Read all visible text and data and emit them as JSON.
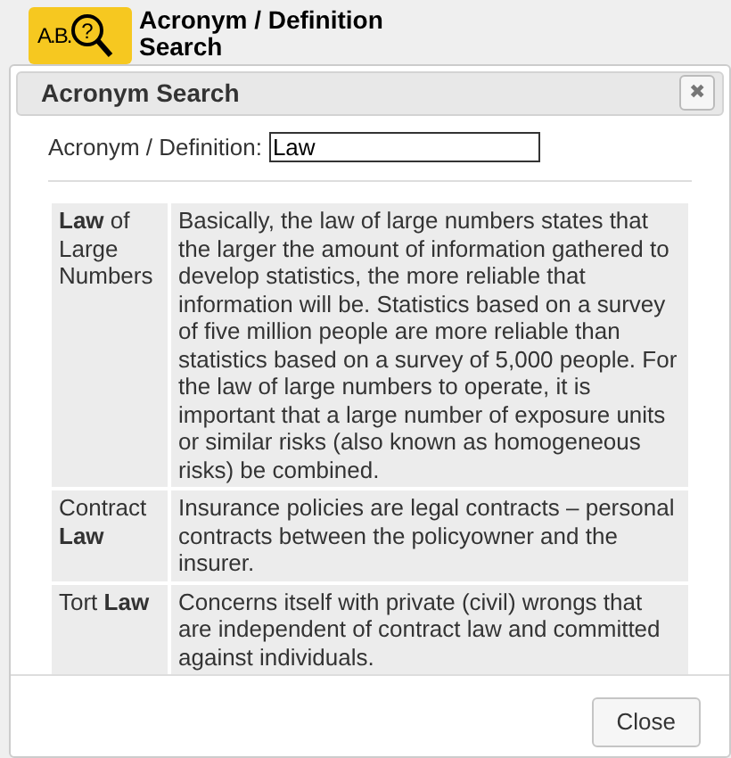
{
  "header": {
    "logo": {
      "letters": "A.B.",
      "mark": "?"
    },
    "title": "Acronym / Definition Search"
  },
  "dialog": {
    "title": "Acronym Search",
    "close_icon": "✖",
    "search": {
      "label": "Acronym / Definition:",
      "value": "Law"
    },
    "results": [
      {
        "term": "**Law** of Large Numbers",
        "definition": "Basically, the law of large numbers states that the larger the amount of information gathered to develop statistics, the more reliable that information will be. Statistics based on a survey of five million people are more reliable than statistics based on a survey of 5,000 people. For the law of large numbers to operate, it is important that a large number of exposure units or similar risks (also known as homogeneous risks) be combined."
      },
      {
        "term": "Contract **Law**",
        "definition": "Insurance policies are legal contracts – personal contracts between the policyowner and the insurer."
      },
      {
        "term": "Tort **Law**",
        "definition": "Concerns itself with private (civil) wrongs that are independent of contract law and committed against individuals."
      }
    ],
    "buttons": [
      "Close"
    ]
  }
}
